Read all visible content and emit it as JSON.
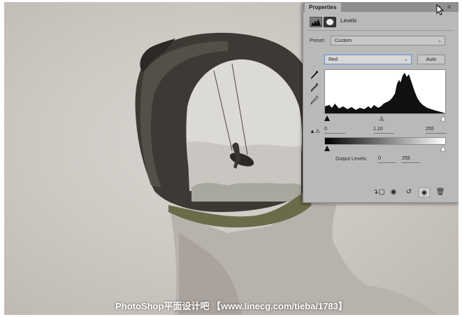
{
  "panel": {
    "tab_title": "Properties",
    "heading": "Levels",
    "preset_label": "Preset:",
    "preset_value": "Custom",
    "channel_value": "Red",
    "auto_label": "Auto",
    "input_black": "0",
    "input_gamma": "1.10",
    "input_white": "255",
    "output_label": "Output Levels:",
    "output_black": "0",
    "output_white": "255"
  },
  "icons": {
    "levels": "levels-icon",
    "mask": "mask-icon",
    "black_eyedropper": "eyedropper-black-icon",
    "gray_eyedropper": "eyedropper-gray-icon",
    "white_eyedropper": "eyedropper-white-icon",
    "clip": "clip-to-layer-icon",
    "view_previous": "view-previous-icon",
    "reset": "reset-icon",
    "visibility": "eye-icon",
    "delete": "trash-icon"
  },
  "watermark": "PhotoShop平面设计吧 【www.linecg.com/tieba/1783】"
}
